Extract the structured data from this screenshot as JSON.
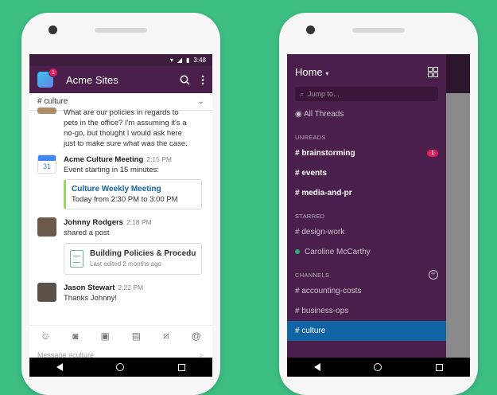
{
  "status": {
    "time": "3:48"
  },
  "left": {
    "workspace": "Acme Sites",
    "workspace_badge": "1",
    "channel": "# culture",
    "messages": [
      {
        "text": "What are our policies in regards to pets in the office? I'm assuming it's a no-go, but thought I would ask here just to make sure what was the case."
      },
      {
        "name": "Acme Culture Meeting",
        "time": "2:15 PM",
        "text": "Event starting in 15 minutes:",
        "calendar_day": "31",
        "attachment": {
          "title": "Culture Weekly Meeting",
          "subtitle": "Today from 2:30 PM to 3:00 PM"
        }
      },
      {
        "name": "Johnny Rodgers",
        "time": "2:18 PM",
        "text": "shared a post",
        "post": {
          "title": "Building Policies & Procedu...",
          "subtitle": "Last edited 2 months ago"
        }
      },
      {
        "name": "Jason Stewart",
        "time": "2:22 PM",
        "text": "Thanks Johnny!"
      }
    ],
    "composer_placeholder": "Message #culture"
  },
  "right": {
    "home_label": "Home",
    "jump_placeholder": "Jump to...",
    "all_threads": "All Threads",
    "sections": {
      "unreads": "UNREADS",
      "starred": "STARRED",
      "channels": "CHANNELS"
    },
    "unreads": [
      {
        "label": "# brainstorming",
        "badge": "1"
      },
      {
        "label": "# events"
      },
      {
        "label": "# media-and-pr"
      }
    ],
    "starred": [
      {
        "label": "# design-work"
      },
      {
        "label": "Caroline McCarthy"
      }
    ],
    "channels": [
      {
        "label": "# accounting-costs"
      },
      {
        "label": "# business-ops"
      },
      {
        "label": "# culture"
      }
    ]
  },
  "colors": {
    "aubergine": "#4a1f4c",
    "active": "#1164a3",
    "background": "#3dbf84"
  }
}
